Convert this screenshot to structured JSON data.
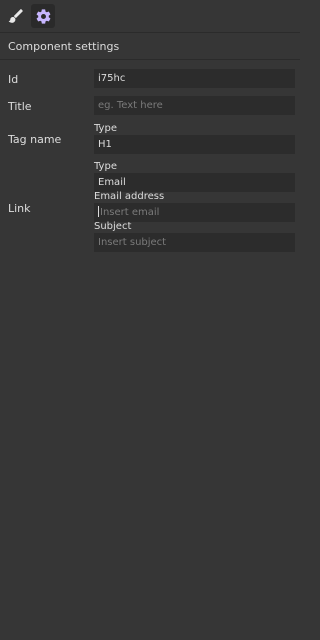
{
  "toolbar": {
    "style_icon": "paint-brush-icon",
    "settings_icon": "gear-icon",
    "accent": "#c7b6ff"
  },
  "panel": {
    "title": "Component settings"
  },
  "fields": {
    "id": {
      "label": "Id",
      "value": "i75hc"
    },
    "title": {
      "label": "Title",
      "placeholder": "eg. Text here",
      "value": ""
    },
    "tag_name": {
      "label": "Tag name",
      "type_label": "Type",
      "value": "H1"
    },
    "link": {
      "label": "Link",
      "type_label": "Type",
      "type_value": "Email",
      "email_label": "Email address",
      "email_placeholder": "Insert email",
      "subject_label": "Subject",
      "subject_placeholder": "Insert subject"
    }
  }
}
